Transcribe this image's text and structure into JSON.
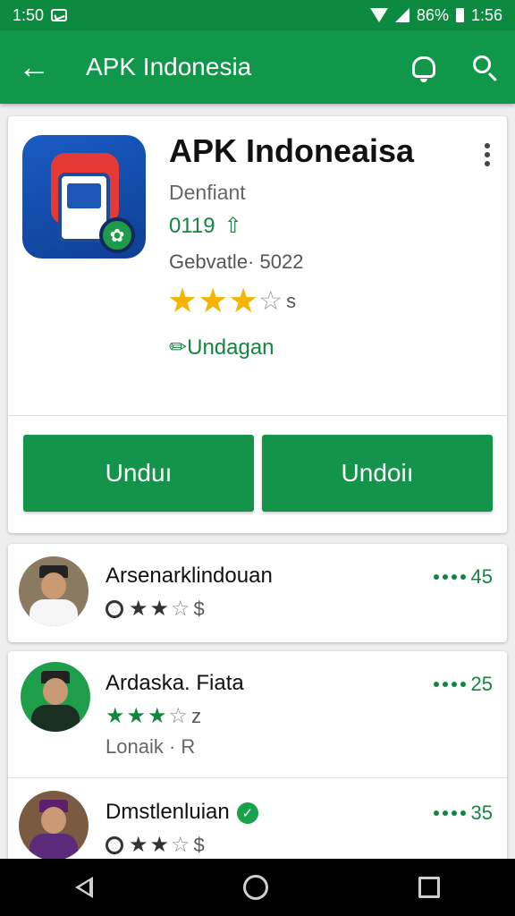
{
  "status_bar": {
    "time_left": "1:50",
    "battery": "86%",
    "time_right": "1:56"
  },
  "app_bar": {
    "title": "APK Indonesia"
  },
  "app": {
    "name": "APK Indoneaisa",
    "developer": "Denfiant",
    "count": "0119",
    "version": "Gebvatle· 5022",
    "rating_stars": 3,
    "rating_suffix": "s",
    "category": "Undagan",
    "icon_colors": {
      "background": "#1a5bc4",
      "accent": "#e53935",
      "badge": "#1f9a48"
    }
  },
  "buttons": [
    {
      "label": "Unduı"
    },
    {
      "label": "Undoiı"
    }
  ],
  "reviews": [
    {
      "name": "Arsenarklindouan",
      "stars": 2,
      "star_suffix": "$",
      "score": "45",
      "verified": false
    },
    {
      "name": "Ardaska. Fiata",
      "stars": 3,
      "star_suffix": "z",
      "score": "25",
      "subtext": "Lonaik · R",
      "verified": false
    },
    {
      "name": "Dmstlenluian",
      "stars": 2,
      "star_suffix": "$",
      "score": "35",
      "verified": true
    }
  ],
  "colors": {
    "primary": "#11974a",
    "status_bar": "#0c8a3f",
    "star": "#f4b400",
    "accent_text": "#13853f"
  }
}
